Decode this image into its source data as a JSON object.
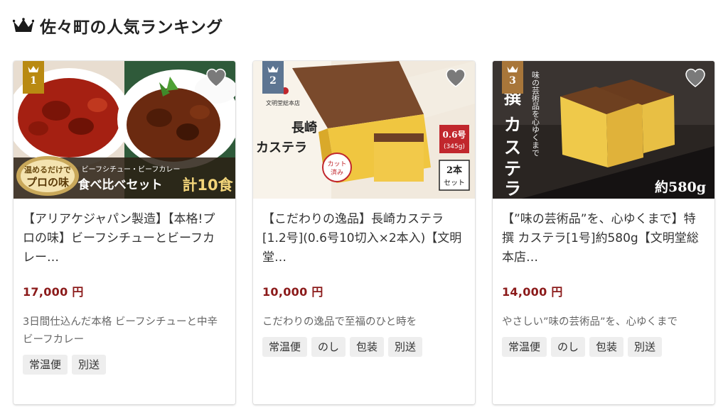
{
  "header": {
    "title": "佐々町の人気ランキング",
    "icon": "crown-icon"
  },
  "colors": {
    "price": "#8b1a1a",
    "rank1": "#b98a12",
    "rank2": "#5d7592",
    "rank3": "#a8763a"
  },
  "items": [
    {
      "rank": "1",
      "name": "【アリアケジャパン製造】【本格!プロの味】ビーフシチューとビーフカレー…",
      "price": "17,000 円",
      "desc": "3日間仕込んだ本格 ビーフシチューと中辛 ビーフカレー",
      "tags": [
        "常温便",
        "別送"
      ],
      "image_text": {
        "badge": "温めるだけで プロの味",
        "sub": "ビーフシチュー・ビーフカレー",
        "main": "食べ比べセット",
        "count": "計10食"
      }
    },
    {
      "rank": "2",
      "name": "【こだわりの逸品】長崎カステラ[1.2号](0.6号10切入×2本入)【文明堂…",
      "price": "10,000 円",
      "desc": "こだわりの逸品で至福のひと時を",
      "tags": [
        "常温便",
        "のし",
        "包装",
        "別送"
      ],
      "image_text": {
        "brand": "文明堂総本店",
        "title": "長崎 カステラ",
        "cut": "カット 済み",
        "size": "0.6号",
        "weight": "(345g)",
        "set": "2本 セット"
      }
    },
    {
      "rank": "3",
      "name": "【”味の芸術品”を、心ゆくまで】特撰 カステラ[1号]約580g【文明堂総本店…",
      "price": "14,000 円",
      "desc": "やさしい”味の芸術品”を、心ゆくまで",
      "tags": [
        "常温便",
        "のし",
        "包装",
        "別送"
      ],
      "image_text": {
        "title": "撰 カステラ",
        "tagline": "味の芸術品を心ゆくまで",
        "weight": "約580g"
      }
    }
  ]
}
